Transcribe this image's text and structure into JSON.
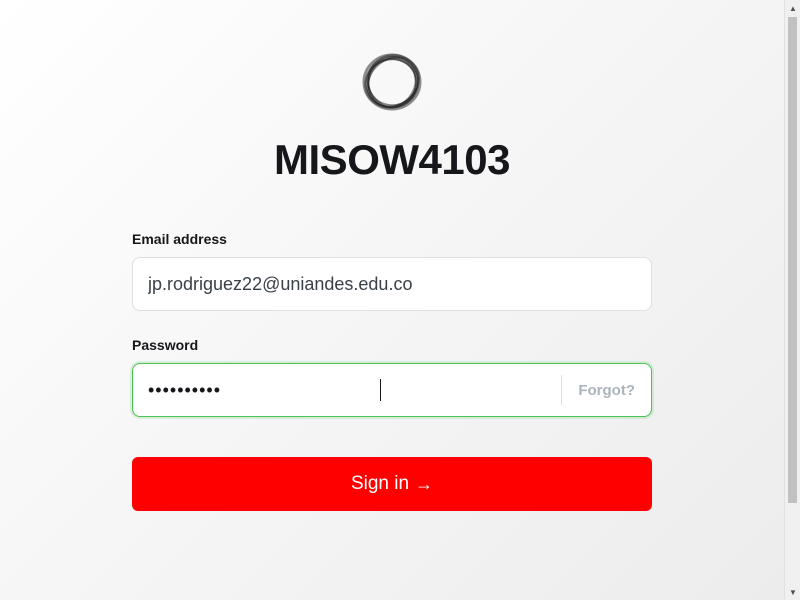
{
  "brand": {
    "logo_icon": "ghost-ring-logo-icon",
    "title": "MISOW4103"
  },
  "form": {
    "email_label": "Email address",
    "email_value": "jp.rodriguez22@uniandes.edu.co",
    "password_label": "Password",
    "password_value": "••••••••••",
    "forgot_label": "Forgot?",
    "signin_label": "Sign in",
    "signin_arrow": "→"
  },
  "colors": {
    "primary_button": "#ff0000",
    "focus_border": "#4cc257",
    "title_text": "#15171a",
    "muted_text": "#abb4be"
  },
  "scrollbar": {
    "up_arrow": "▲",
    "down_arrow": "▼"
  }
}
